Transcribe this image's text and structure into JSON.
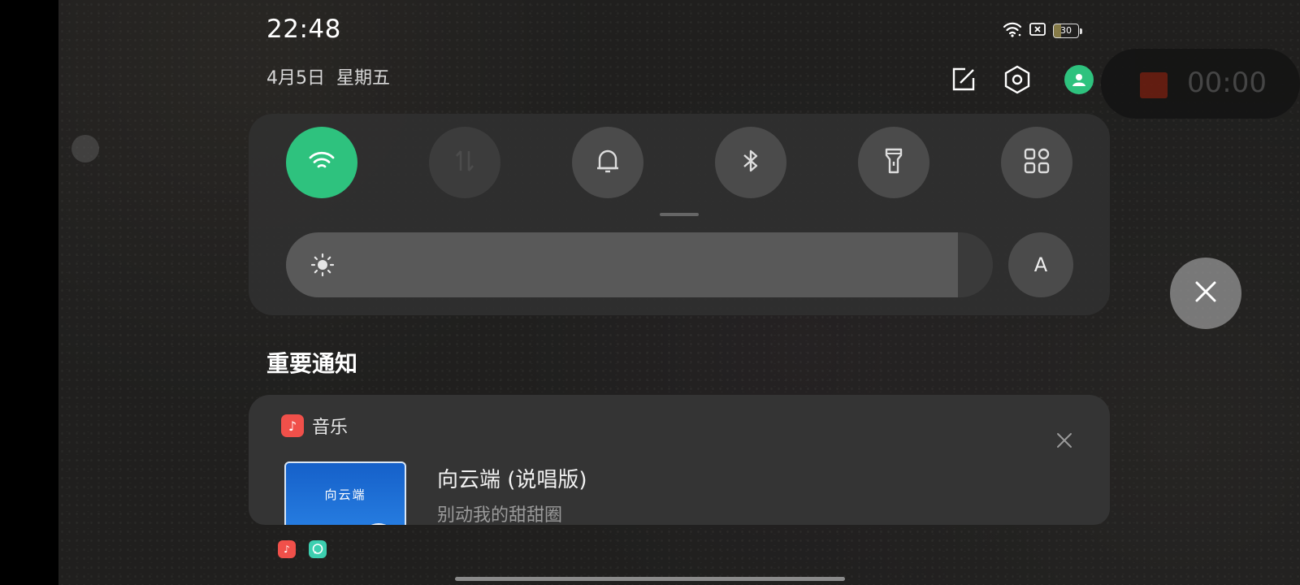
{
  "status_bar": {
    "time": "22:48",
    "date": "4月5日",
    "weekday": "星期五",
    "battery": "30",
    "icons": [
      "wifi-icon",
      "sim-blocked-icon",
      "battery-icon"
    ]
  },
  "header_actions": [
    "edit-icon",
    "settings-icon",
    "user-avatar-icon"
  ],
  "screen_recorder": {
    "timer": "00:00"
  },
  "quick_settings": {
    "tiles": [
      {
        "name": "wifi",
        "icon": "wifi-icon",
        "state": "on"
      },
      {
        "name": "mobile-data",
        "icon": "data-arrows-icon",
        "state": "disabled"
      },
      {
        "name": "ring",
        "icon": "bell-icon",
        "state": "off"
      },
      {
        "name": "bluetooth",
        "icon": "bluetooth-icon",
        "state": "off"
      },
      {
        "name": "flashlight",
        "icon": "flashlight-icon",
        "state": "off"
      },
      {
        "name": "more",
        "icon": "grid-icon",
        "state": "off"
      }
    ],
    "brightness_level": 0.95,
    "auto_brightness_label": "A"
  },
  "notifications": {
    "section_title": "重要通知",
    "items": [
      {
        "app_name": "音乐",
        "app_icon": "music-note-icon",
        "title": "向云端 (说唱版)",
        "subtitle": "别动我的甜甜圈",
        "cover_text": "向云端"
      }
    ],
    "collapsed_app_icons": [
      "music-app-icon",
      "chat-app-icon"
    ]
  },
  "colors": {
    "accent_green": "#2ec27e",
    "music_red": "#f0504a",
    "chat_teal": "#3ccfb0"
  }
}
